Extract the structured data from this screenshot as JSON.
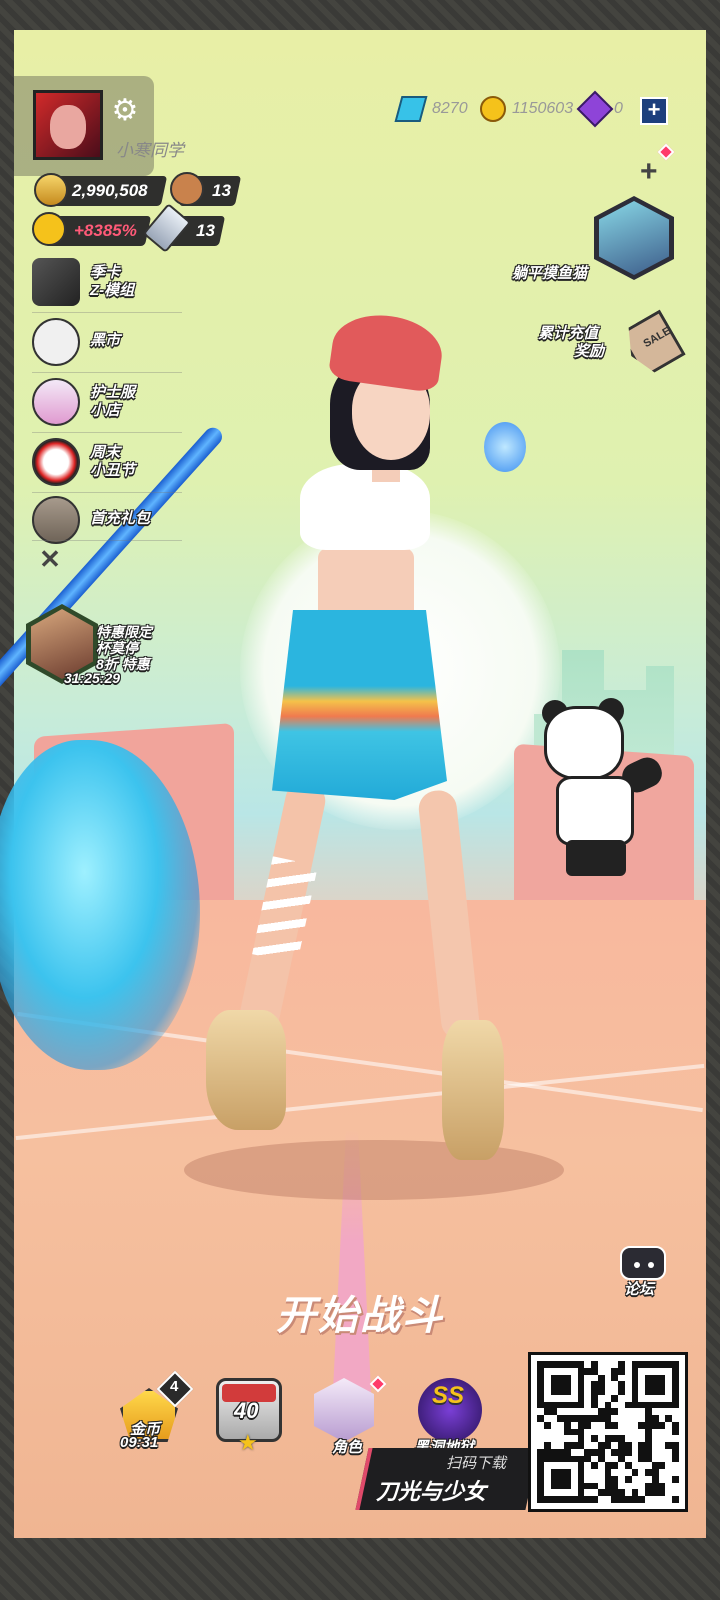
{
  "player": {
    "name": "小寒同学",
    "trophies": "2,990,508",
    "bear_count": "13",
    "bonus": "+8385%",
    "sword_count": "13"
  },
  "currency": {
    "gems": "8270",
    "gold": "1150603",
    "tickets": "0"
  },
  "left_menu": [
    {
      "label_line1": "季卡",
      "label_line2": "Z-模组",
      "icon": "z-card-icon"
    },
    {
      "label_line1": "黑市",
      "label_line2": "",
      "icon": "spade-icon"
    },
    {
      "label_line1": "护士服",
      "label_line2": "小店",
      "icon": "nurse-shop-icon"
    },
    {
      "label_line1": "周末",
      "label_line2": "小丑节",
      "icon": "clown-icon"
    },
    {
      "label_line1": "首充礼包",
      "label_line2": "",
      "icon": "gift-pig-icon"
    }
  ],
  "promo": {
    "title": "特惠限定",
    "name": "杯莫停",
    "discount": "8折 特惠",
    "timer": "31:25:29"
  },
  "right_menu": {
    "fishing_label": "躺平摸鱼猫",
    "recharge_line1": "累计充值",
    "recharge_line2": "奖励",
    "sale_tag": "SALE"
  },
  "main": {
    "start_battle": "开始战斗",
    "forum": "论坛"
  },
  "bottom_bar": {
    "coins_badge_count": "4",
    "coins_label": "金币",
    "coins_timer": "09:31",
    "level": "40",
    "character_label": "角色",
    "ss_label": "SS",
    "ss_sub": "黑洞地狱"
  },
  "qr_overlay": {
    "scan_label": "扫码下载",
    "game_title": "刀光与少女"
  },
  "colors": {
    "accent_red": "#d23b3b",
    "accent_blue": "#1d3f7d",
    "gold": "#e69c1d",
    "notification": "#ff3b6a"
  }
}
